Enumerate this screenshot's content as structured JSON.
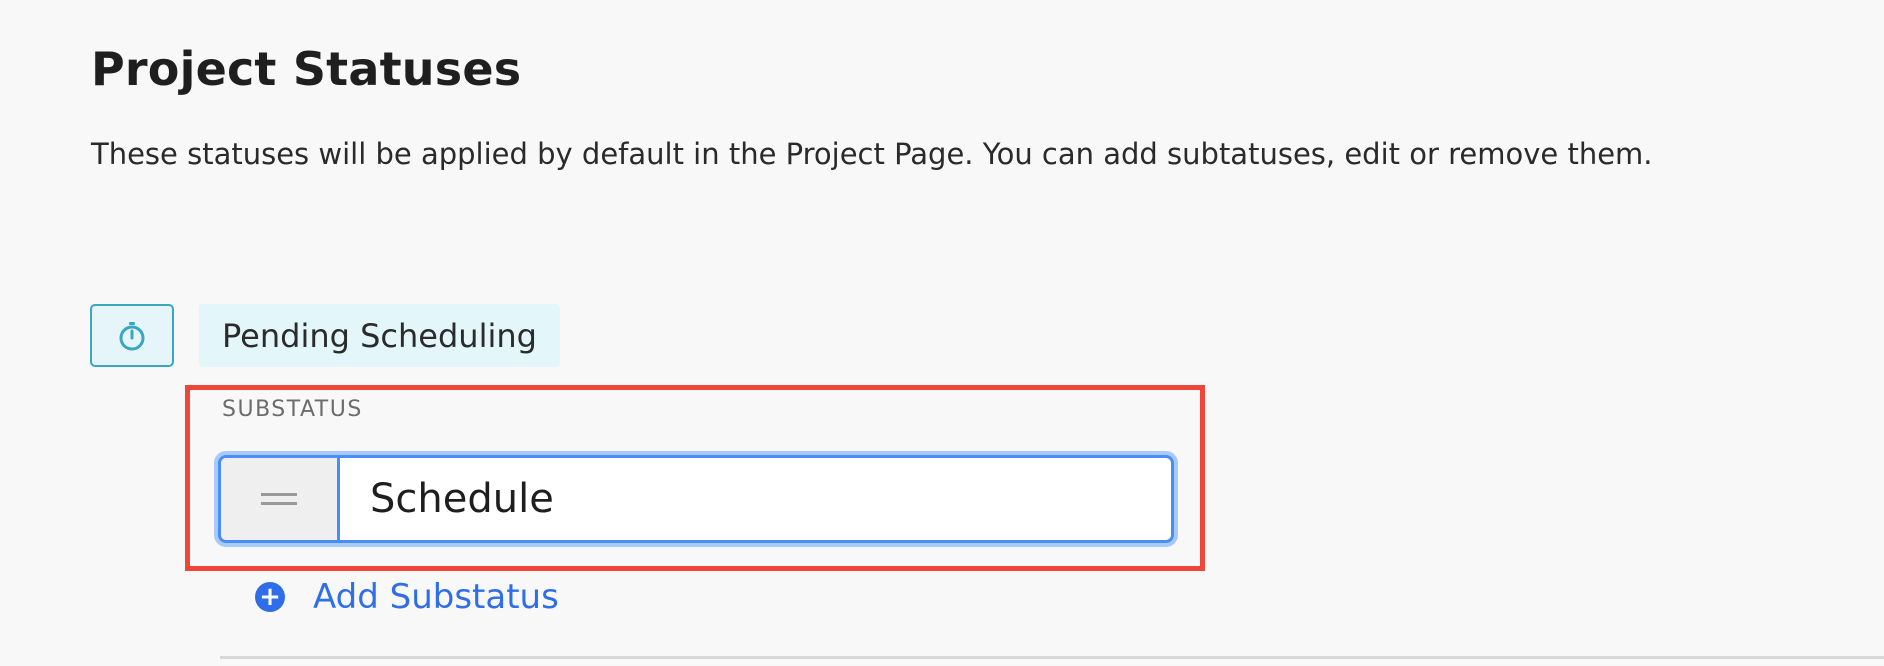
{
  "page": {
    "title": "Project Statuses",
    "description": "These statuses will be applied by default in the Project Page. You can add subtatuses, edit or remove them."
  },
  "status": {
    "icon": "stopwatch-icon",
    "name": "Pending Scheduling",
    "accent_color": "#3aa7c0",
    "chip_background": "#e3f6fa"
  },
  "substatus": {
    "section_label": "SUBSTATUS",
    "drag_handle_icon": "drag-handle-icon",
    "input_value": "Schedule",
    "focus_color": "#4a8ef5"
  },
  "actions": {
    "add_substatus_label": "Add Substatus",
    "add_icon": "plus-circle-icon",
    "link_color": "#2f6ee8"
  },
  "annotation": {
    "highlight_color": "#f0463a"
  }
}
